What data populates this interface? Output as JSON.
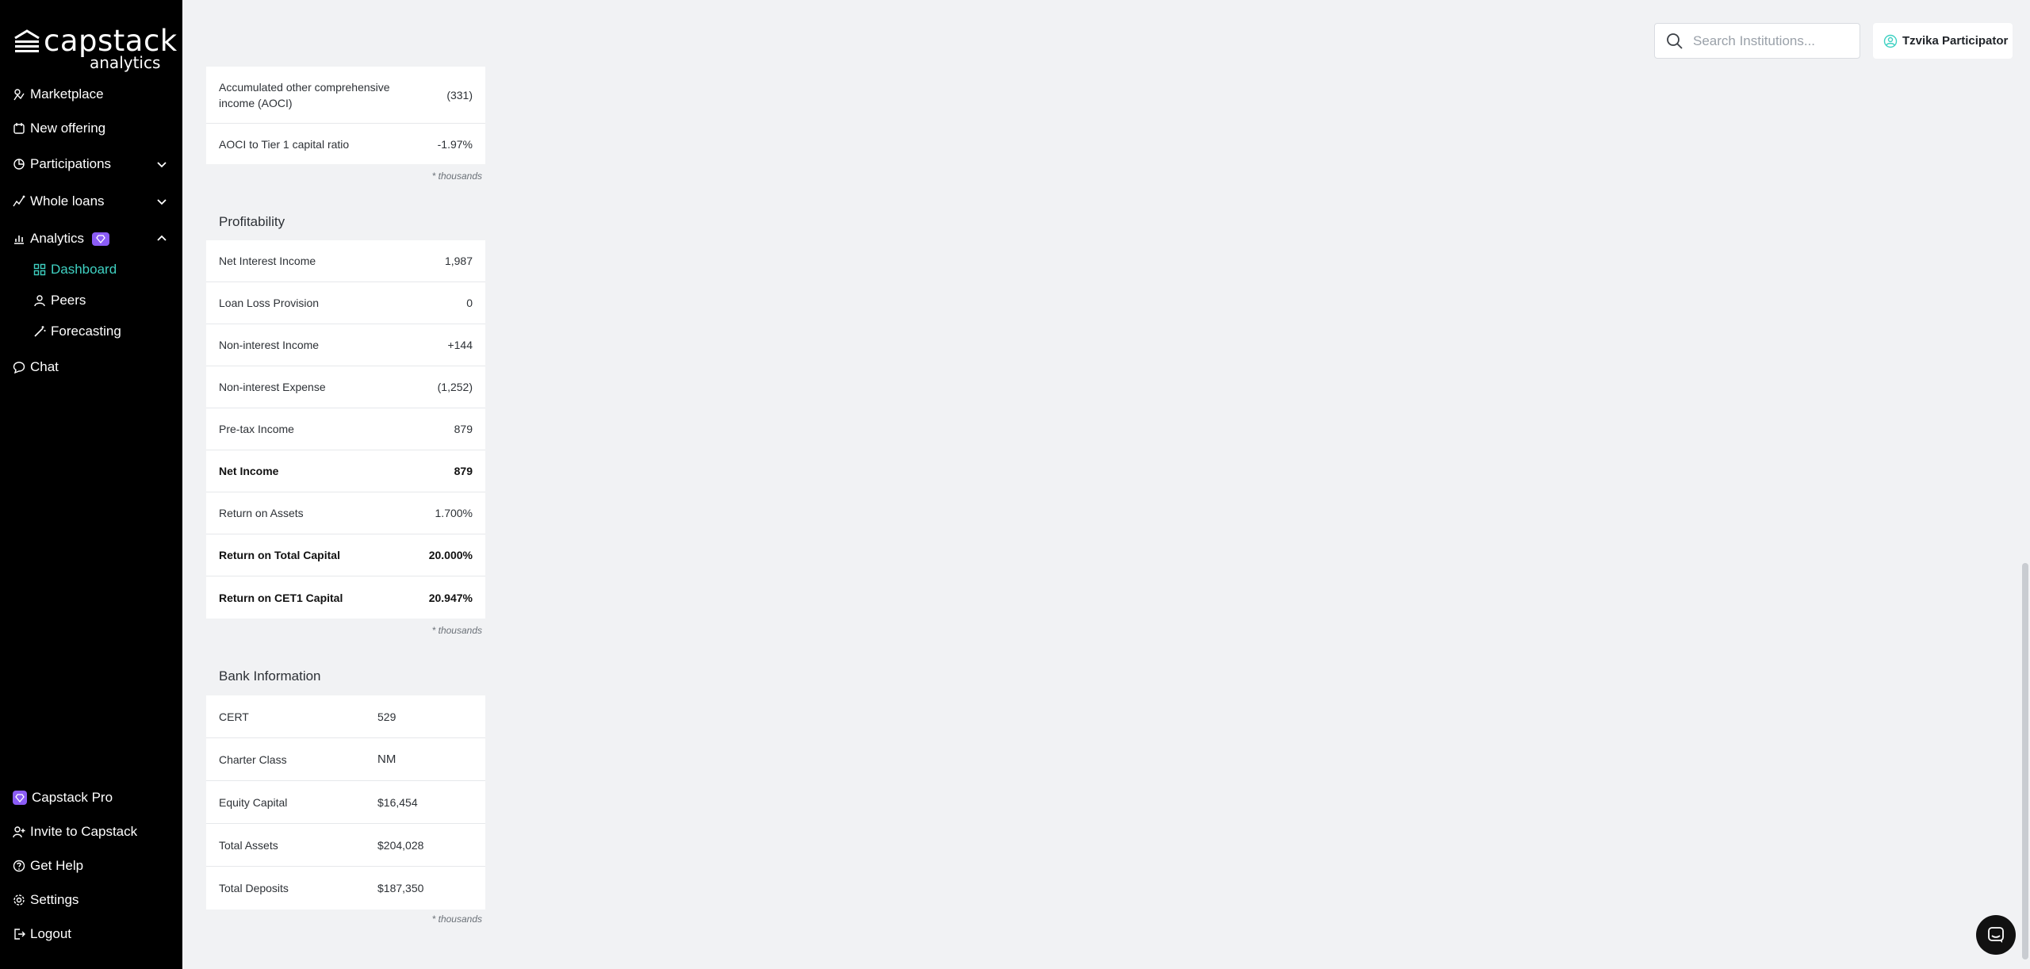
{
  "brand": {
    "name": "capstack",
    "sub": "analytics"
  },
  "sidebar": {
    "items": [
      {
        "label": "Marketplace"
      },
      {
        "label": "New offering"
      },
      {
        "label": "Participations"
      },
      {
        "label": "Whole loans"
      },
      {
        "label": "Analytics"
      },
      {
        "label": "Dashboard"
      },
      {
        "label": "Peers"
      },
      {
        "label": "Forecasting"
      },
      {
        "label": "Chat"
      }
    ],
    "bottom": [
      {
        "label": "Capstack Pro"
      },
      {
        "label": "Invite to Capstack"
      },
      {
        "label": "Get Help"
      },
      {
        "label": "Settings"
      },
      {
        "label": "Logout"
      }
    ]
  },
  "header": {
    "search_placeholder": "Search Institutions...",
    "user_name": "Tzvika Participator"
  },
  "capital": {
    "rows": [
      {
        "label": "Accumulated other comprehensive income (AOCI)",
        "value": "(331)"
      },
      {
        "label": "AOCI to Tier 1 capital ratio",
        "value": "-1.97%"
      }
    ],
    "note": "* thousands"
  },
  "profitability": {
    "title": "Profitability",
    "rows": [
      {
        "label": "Net Interest Income",
        "value": "1,987"
      },
      {
        "label": "Loan Loss Provision",
        "value": "0"
      },
      {
        "label": "Non-interest Income",
        "value": "+144"
      },
      {
        "label": "Non-interest Expense",
        "value": "(1,252)"
      },
      {
        "label": "Pre-tax Income",
        "value": "879"
      },
      {
        "label": "Net Income",
        "value": "879"
      },
      {
        "label": "Return on Assets",
        "value": "1.700%"
      },
      {
        "label": "Return on Total Capital",
        "value": "20.000%"
      },
      {
        "label": "Return on CET1 Capital",
        "value": "20.947%"
      }
    ],
    "note": "* thousands"
  },
  "bank_info": {
    "title": "Bank Information",
    "rows": [
      {
        "label": "CERT",
        "value": "529"
      },
      {
        "label": "Charter Class",
        "value": "NM"
      },
      {
        "label": "Equity Capital",
        "value": "$16,454"
      },
      {
        "label": "Total Assets",
        "value": "$204,028"
      },
      {
        "label": "Total Deposits",
        "value": "$187,350"
      }
    ],
    "note": "* thousands"
  },
  "colors": {
    "accent": "#3fd1c2",
    "pro": "#8b5cf6",
    "sidebar_bg": "#000000",
    "page_bg": "#f1f2f4"
  }
}
